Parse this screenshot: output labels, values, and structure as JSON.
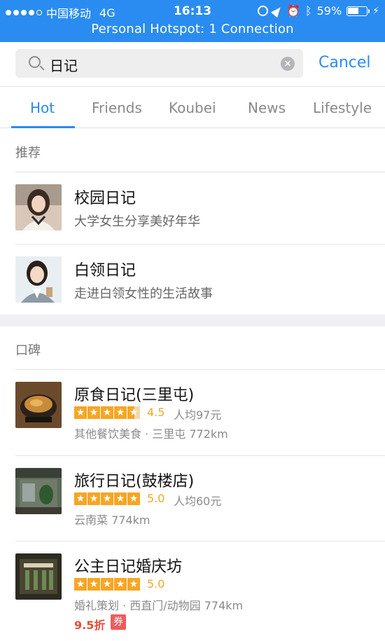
{
  "status_bar": {
    "carrier": "中国移动",
    "network": "4G",
    "time": "16:13",
    "battery": "59%",
    "battery_level": 0.59,
    "hotspot": "Personal Hotspot: 1 Connection",
    "icons": [
      "signal-dots-icon",
      "rotation-lock-icon",
      "location-arrow-icon",
      "alarm-icon",
      "bluetooth-icon",
      "battery-icon",
      "charging-bolt-icon"
    ]
  },
  "search": {
    "query": "日记",
    "cancel_label": "Cancel",
    "icons": [
      "search-icon",
      "clear-icon"
    ]
  },
  "tabs": [
    {
      "label": "Hot",
      "active": true
    },
    {
      "label": "Friends",
      "active": false
    },
    {
      "label": "Koubei",
      "active": false
    },
    {
      "label": "News",
      "active": false
    },
    {
      "label": "Lifestyle",
      "active": false
    }
  ],
  "recommended": {
    "header": "推荐",
    "items": [
      {
        "title": "校园日记",
        "subtitle": "大学女生分享美好年华"
      },
      {
        "title": "白领日记",
        "subtitle": "走进白领女性的生活故事"
      }
    ]
  },
  "koubei": {
    "header": "口碑",
    "items": [
      {
        "title": "原食日记(三里屯)",
        "rating": "4.5",
        "stars": 4.5,
        "avg_price": "人均97元",
        "meta": "其他餐饮美食 · 三里屯 772km"
      },
      {
        "title": "旅行日记(鼓楼店)",
        "rating": "5.0",
        "stars": 5,
        "avg_price": "人均60元",
        "meta": "云南菜 774km"
      },
      {
        "title": "公主日记婚庆坊",
        "rating": "5.0",
        "stars": 5,
        "meta": "婚礼策划 · 西直门/动物园 774km",
        "discount": "9.5折",
        "coupon": "券"
      }
    ]
  },
  "colors": {
    "accent": "#2a8cf0",
    "star": "#f6a623",
    "discount": "#e74c3c"
  }
}
